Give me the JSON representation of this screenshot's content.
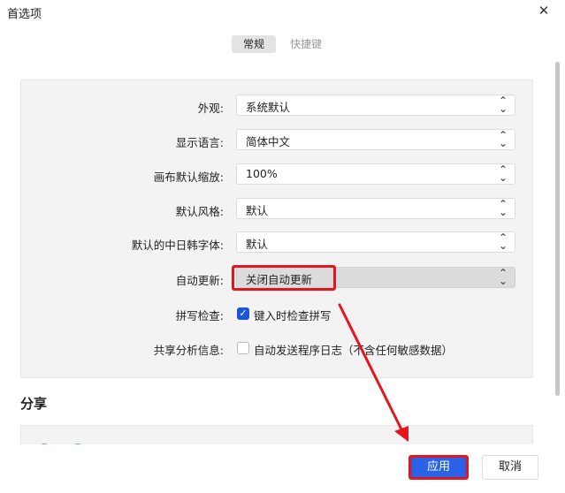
{
  "window": {
    "title": "首选项",
    "close_glyph": "✕"
  },
  "tabs": [
    {
      "label": "常规",
      "active": true
    },
    {
      "label": "快捷键",
      "active": false
    }
  ],
  "general": {
    "appearance": {
      "label": "外观:",
      "value": "系统默认"
    },
    "language": {
      "label": "显示语言:",
      "value": "简体中文"
    },
    "zoom": {
      "label": "画布默认缩放:",
      "value": "100%"
    },
    "style": {
      "label": "默认风格:",
      "value": "默认"
    },
    "cjk_font": {
      "label": "默认的中日韩字体:",
      "value": "默认"
    },
    "auto_update": {
      "label": "自动更新:",
      "value": "关闭自动更新"
    },
    "spellcheck": {
      "label": "拼写检查:",
      "option": "键入时检查拼写",
      "checked": true
    },
    "analytics": {
      "label": "共享分析信息:",
      "option": "自动发送程序日志（不含任何敏感数据）",
      "checked": false
    }
  },
  "share": {
    "title": "分享"
  },
  "footer": {
    "apply_label": "应用",
    "cancel_label": "取消"
  },
  "colors": {
    "accent": "#2a62e8",
    "annotation": "#e4151b",
    "checkbox": "#1a56d6"
  },
  "icons": {
    "select_chevron": "chevron-updown-icon",
    "check": "check-icon",
    "close": "close-icon"
  }
}
